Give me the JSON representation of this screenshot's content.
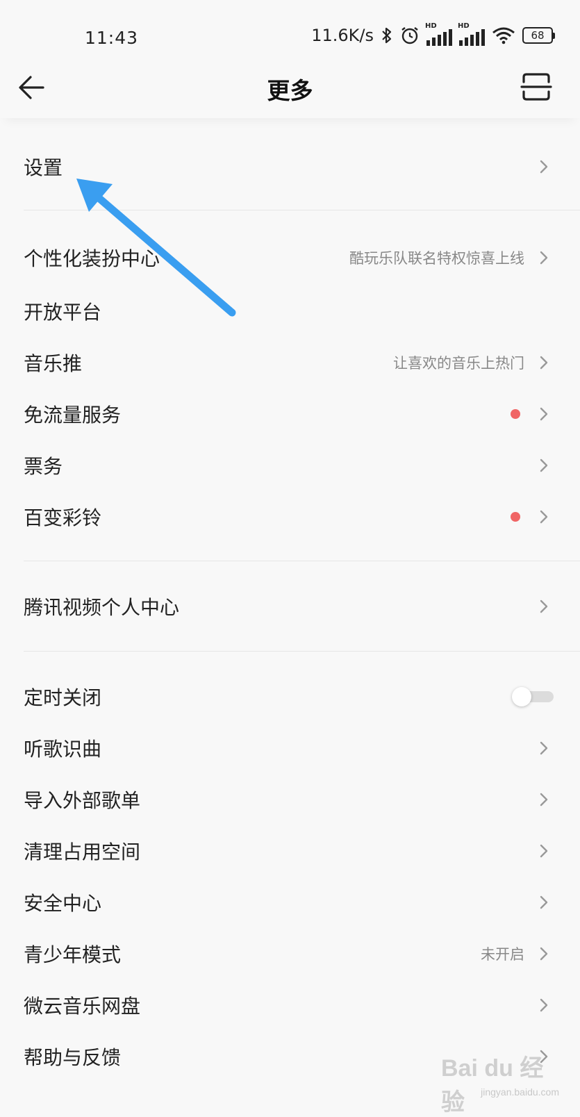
{
  "status_bar": {
    "time": "11:43",
    "network_speed": "11.6K/s",
    "battery_level": "68",
    "signal_label": "HD",
    "icons": [
      "bluetooth-icon",
      "alarm-icon",
      "signal-icon",
      "wifi-icon",
      "battery-icon"
    ]
  },
  "header": {
    "title": "更多",
    "back_icon": "arrow-left-icon",
    "scan_icon": "scan-icon"
  },
  "menu": {
    "settings": {
      "label": "设置"
    },
    "skin_center": {
      "label": "个性化装扮中心",
      "subtitle": "酷玩乐队联名特权惊喜上线"
    },
    "open_platform": {
      "label": "开放平台"
    },
    "music_push": {
      "label": "音乐推",
      "subtitle": "让喜欢的音乐上热门"
    },
    "free_data": {
      "label": "免流量服务",
      "has_badge": true
    },
    "tickets": {
      "label": "票务"
    },
    "ringtone": {
      "label": "百变彩铃",
      "has_badge": true
    },
    "tencent_video": {
      "label": "腾讯视频个人中心"
    },
    "timer_off": {
      "label": "定时关闭",
      "toggle_on": false
    },
    "song_recognition": {
      "label": "听歌识曲"
    },
    "import_playlist": {
      "label": "导入外部歌单"
    },
    "clean_storage": {
      "label": "清理占用空间"
    },
    "security_center": {
      "label": "安全中心"
    },
    "teen_mode": {
      "label": "青少年模式",
      "subtitle": "未开启"
    },
    "weiyun_drive": {
      "label": "微云音乐网盘"
    },
    "help_feedback": {
      "label": "帮助与反馈"
    }
  },
  "colors": {
    "background": "#f8f8f8",
    "badge": "#f06565",
    "annotation_arrow": "#3a9ef0"
  },
  "watermark": {
    "text": "Bai du 经验",
    "url": "jingyan.baidu.com"
  }
}
